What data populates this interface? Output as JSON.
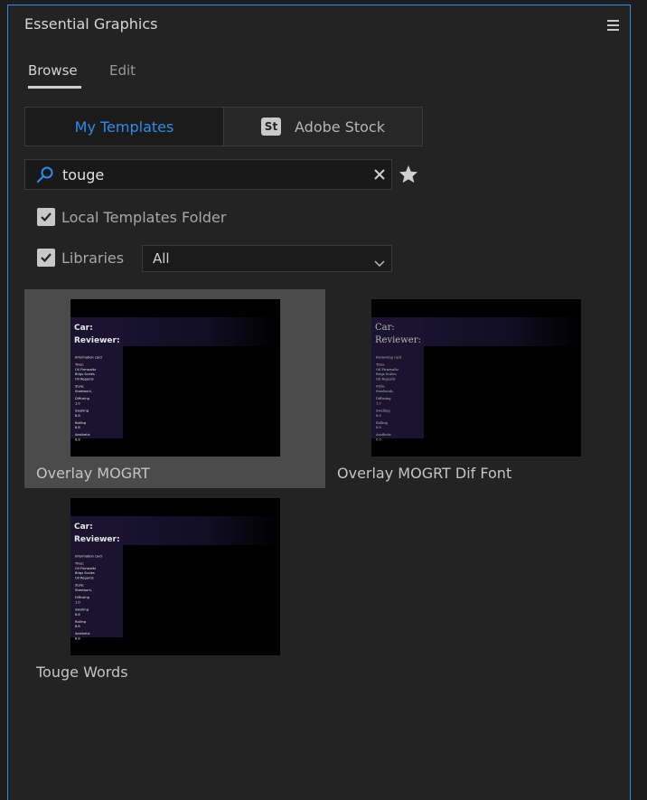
{
  "panel": {
    "title": "Essential Graphics",
    "menu_icon": "hamburger-menu-icon"
  },
  "tabs": [
    {
      "label": "Browse",
      "active": true
    },
    {
      "label": "Edit",
      "active": false
    }
  ],
  "source_toggle": {
    "my_templates": "My Templates",
    "adobe_stock": "Adobe Stock",
    "stock_badge": "St",
    "active_color": "#2d8ceb"
  },
  "search": {
    "value": "touge",
    "icon": "search-icon",
    "clear_icon": "close-icon",
    "favorite_icon": "star-icon"
  },
  "filters": {
    "local_templates": {
      "label": "Local Templates Folder",
      "checked": true
    },
    "libraries": {
      "label": "Libraries",
      "checked": true
    },
    "library_select": {
      "value": "All"
    }
  },
  "templates": [
    {
      "label": "Overlay MOGRT",
      "selected": true,
      "preview": {
        "title1": "Car:",
        "title2": "Reviewer:",
        "lines": [
          "Information card",
          "Tires:",
          "Oil Firmwaltz",
          "Brigs Scales",
          "Oil Regards",
          "Style:",
          "Steelwork,",
          "Diffusing",
          "1.0",
          "Swelling",
          "8.8",
          "Rolling",
          "8.8",
          "Aesthetic",
          "8.8"
        ]
      }
    },
    {
      "label": "Overlay MOGRT Dif Font",
      "selected": false,
      "preview": {
        "title1": "Car:",
        "title2": "Reviewer:",
        "lines": [
          "Reviewing card",
          "Tires:",
          "Oil Firmwaltz",
          "Brigs Scales",
          "Oil Regards",
          "Style:",
          "Steelwork,",
          "Diffusing",
          "1.0",
          "Swelling",
          "8.8",
          "Rolling",
          "8.8",
          "Aesthetic",
          "8.8"
        ]
      }
    },
    {
      "label": "Touge Words",
      "selected": false,
      "preview": {
        "title1": "Car:",
        "title2": "Reviewer:",
        "lines": [
          "Information card",
          "Tires:",
          "Oil Firmwaltz",
          "Brigs Scales",
          "Oil Regards",
          "Style:",
          "Steelwork,",
          "Diffusing",
          "1.0",
          "Swelling",
          "8.8",
          "Rolling",
          "8.8",
          "Aesthetic",
          "8.8"
        ]
      }
    }
  ]
}
